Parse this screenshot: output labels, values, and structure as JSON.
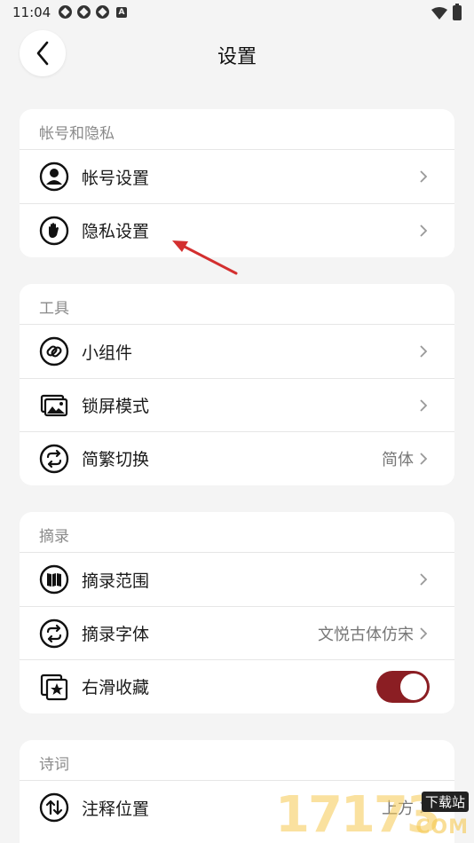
{
  "status_bar": {
    "time": "11:04"
  },
  "header": {
    "title": "设置"
  },
  "sections": [
    {
      "title": "帐号和隐私",
      "rows": [
        {
          "label": "帐号设置",
          "value": "",
          "icon": "user-icon"
        },
        {
          "label": "隐私设置",
          "value": "",
          "icon": "hand-icon"
        }
      ]
    },
    {
      "title": "工具",
      "rows": [
        {
          "label": "小组件",
          "value": "",
          "icon": "link-icon"
        },
        {
          "label": "锁屏模式",
          "value": "",
          "icon": "image-icon"
        },
        {
          "label": "简繁切换",
          "value": "简体",
          "icon": "swap-icon"
        }
      ]
    },
    {
      "title": "摘录",
      "rows": [
        {
          "label": "摘录范围",
          "value": "",
          "icon": "book-icon"
        },
        {
          "label": "摘录字体",
          "value": "文悦古体仿宋",
          "icon": "swap-icon"
        },
        {
          "label": "右滑收藏",
          "toggle": true,
          "toggle_on": true,
          "icon": "star-icon"
        }
      ]
    },
    {
      "title": "诗词",
      "rows": [
        {
          "label": "注释位置",
          "value": "上方",
          "icon": "sort-icon"
        }
      ]
    }
  ],
  "colors": {
    "accent": "#8b1e23",
    "annotation_arrow": "#d32f2f",
    "background": "#f4f4f4"
  },
  "watermark": {
    "digits": "17173",
    "tag": "下载站",
    "domain": "COM"
  }
}
